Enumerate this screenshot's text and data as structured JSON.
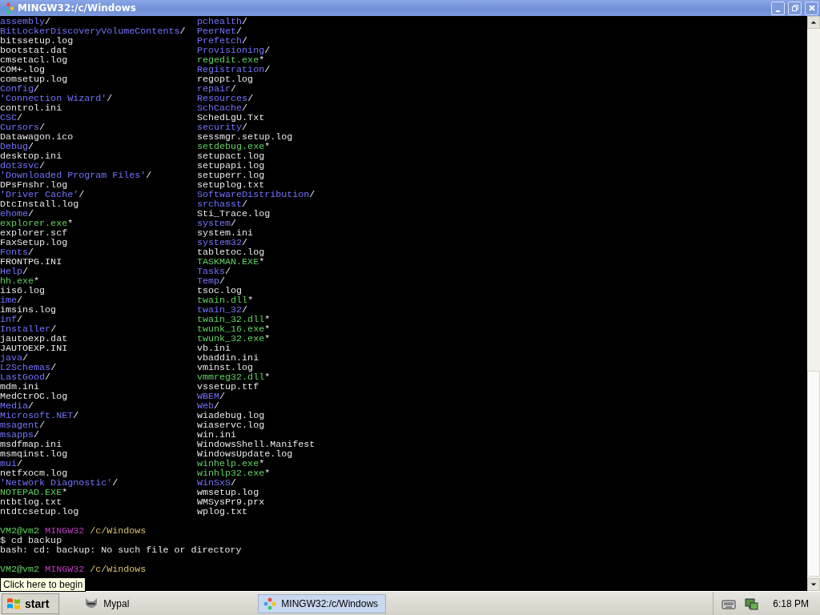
{
  "window": {
    "title": "MINGW32:/c/Windows"
  },
  "terminal": {
    "columns": [
      [
        {
          "name": "assembly",
          "suffix": "/",
          "kind": "dir"
        },
        {
          "name": "BitLockerDiscoveryVolumeContents",
          "suffix": "/",
          "kind": "dir"
        },
        {
          "name": "bitssetup.log",
          "kind": "file"
        },
        {
          "name": "bootstat.dat",
          "kind": "file"
        },
        {
          "name": "cmsetacl.log",
          "kind": "file"
        },
        {
          "name": "COM+.log",
          "kind": "file"
        },
        {
          "name": "comsetup.log",
          "kind": "file"
        },
        {
          "name": "Config",
          "suffix": "/",
          "kind": "dir"
        },
        {
          "name": "'Connection Wizard'",
          "suffix": "/",
          "kind": "dir"
        },
        {
          "name": "control.ini",
          "kind": "file"
        },
        {
          "name": "CSC",
          "suffix": "/",
          "kind": "dir"
        },
        {
          "name": "Cursors",
          "suffix": "/",
          "kind": "dir"
        },
        {
          "name": "Datawagon.ico",
          "kind": "file"
        },
        {
          "name": "Debug",
          "suffix": "/",
          "kind": "dir"
        },
        {
          "name": "desktop.ini",
          "kind": "file"
        },
        {
          "name": "dot3svc",
          "suffix": "/",
          "kind": "dir"
        },
        {
          "name": "'Downloaded Program Files'",
          "suffix": "/",
          "kind": "dir"
        },
        {
          "name": "DPsFnshr.log",
          "kind": "file"
        },
        {
          "name": "'Driver Cache'",
          "suffix": "/",
          "kind": "dir"
        },
        {
          "name": "DtcInstall.log",
          "kind": "file"
        },
        {
          "name": "ehome",
          "suffix": "/",
          "kind": "dir"
        },
        {
          "name": "explorer.exe",
          "suffix": "*",
          "kind": "exe"
        },
        {
          "name": "explorer.scf",
          "kind": "file"
        },
        {
          "name": "FaxSetup.log",
          "kind": "file"
        },
        {
          "name": "Fonts",
          "suffix": "/",
          "kind": "dir"
        },
        {
          "name": "FRONTPG.INI",
          "kind": "file"
        },
        {
          "name": "Help",
          "suffix": "/",
          "kind": "dir"
        },
        {
          "name": "hh.exe",
          "suffix": "*",
          "kind": "exe"
        },
        {
          "name": "iis6.log",
          "kind": "file"
        },
        {
          "name": "ime",
          "suffix": "/",
          "kind": "dir"
        },
        {
          "name": "imsins.log",
          "kind": "file"
        },
        {
          "name": "inf",
          "suffix": "/",
          "kind": "dir"
        },
        {
          "name": "Installer",
          "suffix": "/",
          "kind": "dir"
        },
        {
          "name": "jautoexp.dat",
          "kind": "file"
        },
        {
          "name": "JAUTOEXP.INI",
          "kind": "file"
        },
        {
          "name": "java",
          "suffix": "/",
          "kind": "dir"
        },
        {
          "name": "L2Schemas",
          "suffix": "/",
          "kind": "dir"
        },
        {
          "name": "LastGood",
          "suffix": "/",
          "kind": "dir"
        },
        {
          "name": "mdm.ini",
          "kind": "file"
        },
        {
          "name": "MedCtrOC.log",
          "kind": "file"
        },
        {
          "name": "Media",
          "suffix": "/",
          "kind": "dir"
        },
        {
          "name": "Microsoft.NET",
          "suffix": "/",
          "kind": "dir"
        },
        {
          "name": "msagent",
          "suffix": "/",
          "kind": "dir"
        },
        {
          "name": "msapps",
          "suffix": "/",
          "kind": "dir"
        },
        {
          "name": "msdfmap.ini",
          "kind": "file"
        },
        {
          "name": "msmqinst.log",
          "kind": "file"
        },
        {
          "name": "mui",
          "suffix": "/",
          "kind": "dir"
        },
        {
          "name": "netfxocm.log",
          "kind": "file"
        },
        {
          "name": "'Network Diagnostic'",
          "suffix": "/",
          "kind": "dir"
        },
        {
          "name": "NOTEPAD.EXE",
          "suffix": "*",
          "kind": "exe"
        },
        {
          "name": "ntbtlog.txt",
          "kind": "file"
        },
        {
          "name": "ntdtcsetup.log",
          "kind": "file"
        }
      ],
      [
        {
          "name": "pchealth",
          "suffix": "/",
          "kind": "dir"
        },
        {
          "name": "PeerNet",
          "suffix": "/",
          "kind": "dir"
        },
        {
          "name": "Prefetch",
          "suffix": "/",
          "kind": "dir"
        },
        {
          "name": "Provisioning",
          "suffix": "/",
          "kind": "dir"
        },
        {
          "name": "regedit.exe",
          "suffix": "*",
          "kind": "exe"
        },
        {
          "name": "Registration",
          "suffix": "/",
          "kind": "dir"
        },
        {
          "name": "regopt.log",
          "kind": "file"
        },
        {
          "name": "repair",
          "suffix": "/",
          "kind": "dir"
        },
        {
          "name": "Resources",
          "suffix": "/",
          "kind": "dir"
        },
        {
          "name": "SchCache",
          "suffix": "/",
          "kind": "dir"
        },
        {
          "name": "SchedLgU.Txt",
          "kind": "file"
        },
        {
          "name": "security",
          "suffix": "/",
          "kind": "dir"
        },
        {
          "name": "sessmgr.setup.log",
          "kind": "file"
        },
        {
          "name": "setdebug.exe",
          "suffix": "*",
          "kind": "exe"
        },
        {
          "name": "setupact.log",
          "kind": "file"
        },
        {
          "name": "setupapi.log",
          "kind": "file"
        },
        {
          "name": "setuperr.log",
          "kind": "file"
        },
        {
          "name": "setuplog.txt",
          "kind": "file"
        },
        {
          "name": "SoftwareDistribution",
          "suffix": "/",
          "kind": "dir"
        },
        {
          "name": "srchasst",
          "suffix": "/",
          "kind": "dir"
        },
        {
          "name": "Sti_Trace.log",
          "kind": "file"
        },
        {
          "name": "system",
          "suffix": "/",
          "kind": "dir"
        },
        {
          "name": "system.ini",
          "kind": "file"
        },
        {
          "name": "system32",
          "suffix": "/",
          "kind": "dir"
        },
        {
          "name": "tabletoc.log",
          "kind": "file"
        },
        {
          "name": "TASKMAN.EXE",
          "suffix": "*",
          "kind": "exe"
        },
        {
          "name": "Tasks",
          "suffix": "/",
          "kind": "dir"
        },
        {
          "name": "Temp",
          "suffix": "/",
          "kind": "dir"
        },
        {
          "name": "tsoc.log",
          "kind": "file"
        },
        {
          "name": "twain.dll",
          "suffix": "*",
          "kind": "exe"
        },
        {
          "name": "twain_32",
          "suffix": "/",
          "kind": "dir"
        },
        {
          "name": "twain_32.dll",
          "suffix": "*",
          "kind": "exe"
        },
        {
          "name": "twunk_16.exe",
          "suffix": "*",
          "kind": "exe"
        },
        {
          "name": "twunk_32.exe",
          "suffix": "*",
          "kind": "exe"
        },
        {
          "name": "vb.ini",
          "kind": "file"
        },
        {
          "name": "vbaddin.ini",
          "kind": "file"
        },
        {
          "name": "vminst.log",
          "kind": "file"
        },
        {
          "name": "vmmreg32.dll",
          "suffix": "*",
          "kind": "exe"
        },
        {
          "name": "vssetup.ttf",
          "kind": "file"
        },
        {
          "name": "WBEM",
          "suffix": "/",
          "kind": "dir"
        },
        {
          "name": "Web",
          "suffix": "/",
          "kind": "dir"
        },
        {
          "name": "wiadebug.log",
          "kind": "file"
        },
        {
          "name": "wiaservc.log",
          "kind": "file"
        },
        {
          "name": "win.ini",
          "kind": "file"
        },
        {
          "name": "WindowsShell.Manifest",
          "kind": "file"
        },
        {
          "name": "WindowsUpdate.log",
          "kind": "file"
        },
        {
          "name": "winhelp.exe",
          "suffix": "*",
          "kind": "exe"
        },
        {
          "name": "winhlp32.exe",
          "suffix": "*",
          "kind": "exe"
        },
        {
          "name": "WinSxS",
          "suffix": "/",
          "kind": "dir"
        },
        {
          "name": "wmsetup.log",
          "kind": "file"
        },
        {
          "name": "WMSysPr9.prx",
          "kind": "file"
        },
        {
          "name": "wplog.txt",
          "kind": "file"
        }
      ]
    ],
    "session": [
      {
        "kind": "blank"
      },
      {
        "kind": "prompt",
        "user": "VM2@vm2",
        "shell": "MINGW32",
        "path": "/c/Windows"
      },
      {
        "kind": "command",
        "text": "$ cd backup"
      },
      {
        "kind": "output",
        "text": "bash: cd: backup: No such file or directory"
      },
      {
        "kind": "blank"
      },
      {
        "kind": "prompt",
        "user": "VM2@vm2",
        "shell": "MINGW32",
        "path": "/c/Windows"
      }
    ]
  },
  "tooltip": "Click here to begin",
  "taskbar": {
    "start": "start",
    "tasks": [
      {
        "label": "Mypal",
        "selected": false
      },
      {
        "label": "MINGW32:/c/Windows",
        "selected": true
      }
    ],
    "clock": "6:18 PM"
  }
}
